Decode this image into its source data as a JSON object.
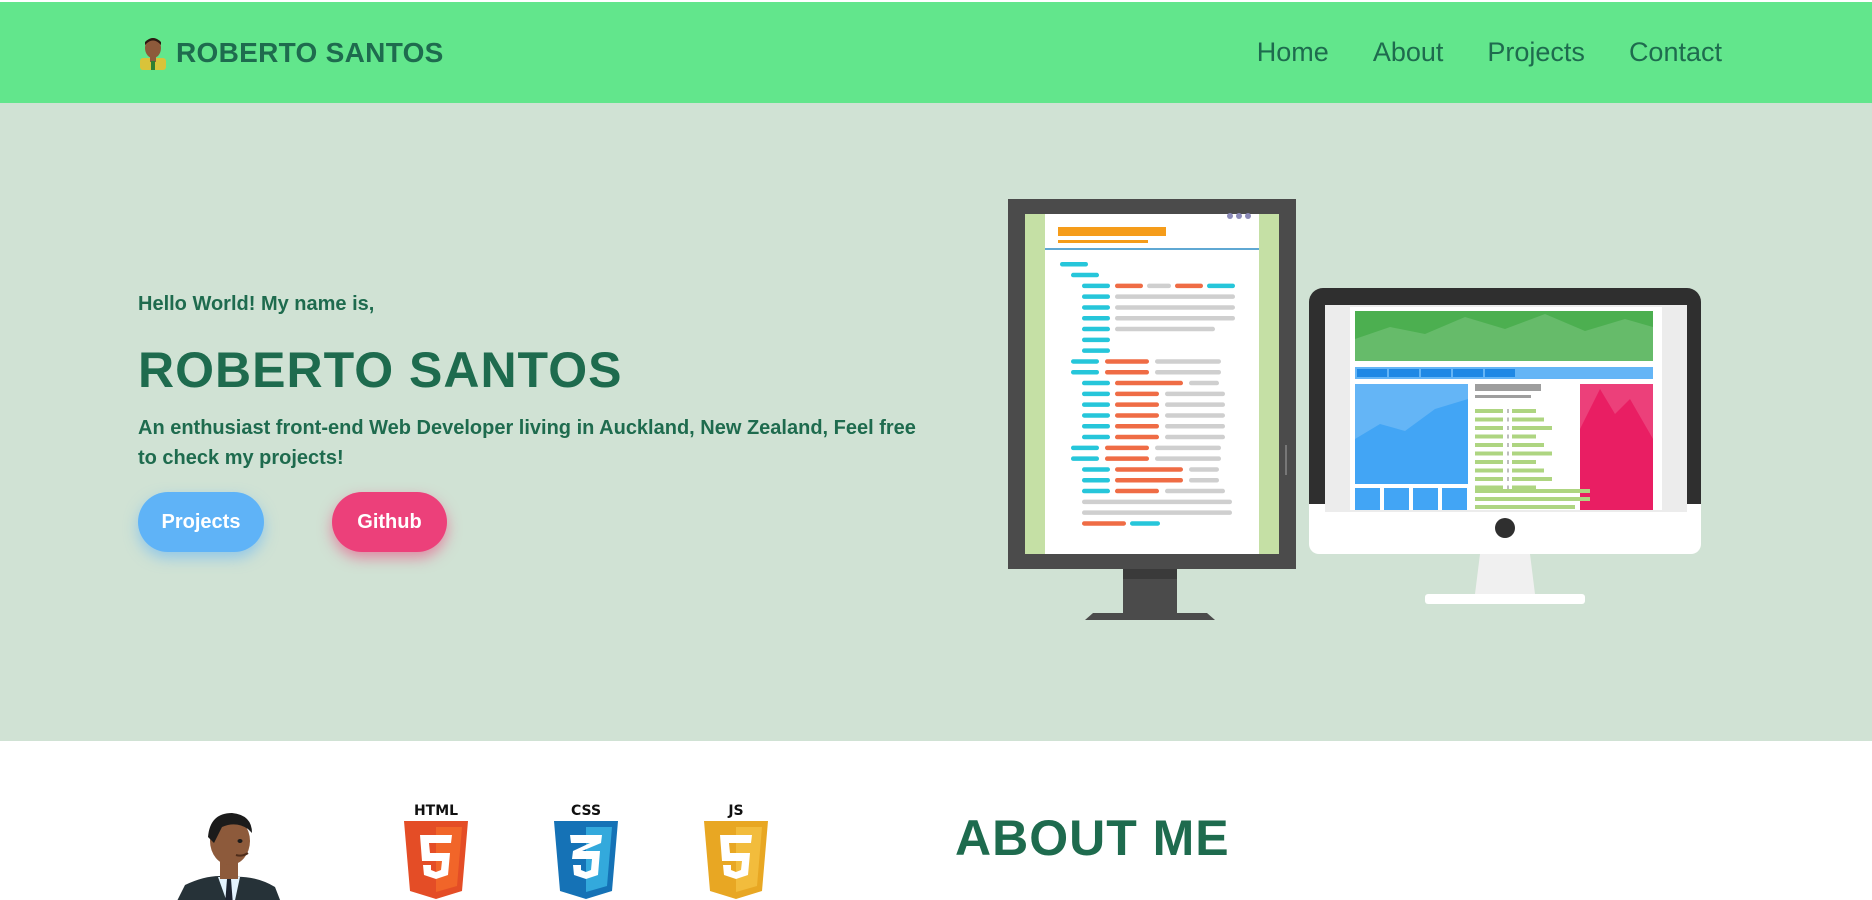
{
  "header": {
    "brand": "ROBERTO SANTOS",
    "nav": [
      "Home",
      "About",
      "Projects",
      "Contact"
    ]
  },
  "hero": {
    "greeting": "Hello World! My name is,",
    "name": "ROBERTO SANTOS",
    "description": "An enthusiast front-end Web Developer living in Auckland, New Zealand, Feel free to check my projects!",
    "buttons": {
      "projects": "Projects",
      "github": "Github"
    }
  },
  "about": {
    "title": "ABOUT ME",
    "tech_labels": [
      "HTML",
      "CSS",
      "JS"
    ]
  },
  "colors": {
    "header": "#62e68c",
    "hero_bg": "#d0e2d4",
    "text": "#1e6b4e",
    "projects_button": "#5fb3f7",
    "github_button": "#ec407a"
  },
  "icons": [
    "developer-avatar-icon",
    "html5-icon",
    "css3-icon",
    "js-icon",
    "monitor-illustration",
    "imac-illustration"
  ]
}
